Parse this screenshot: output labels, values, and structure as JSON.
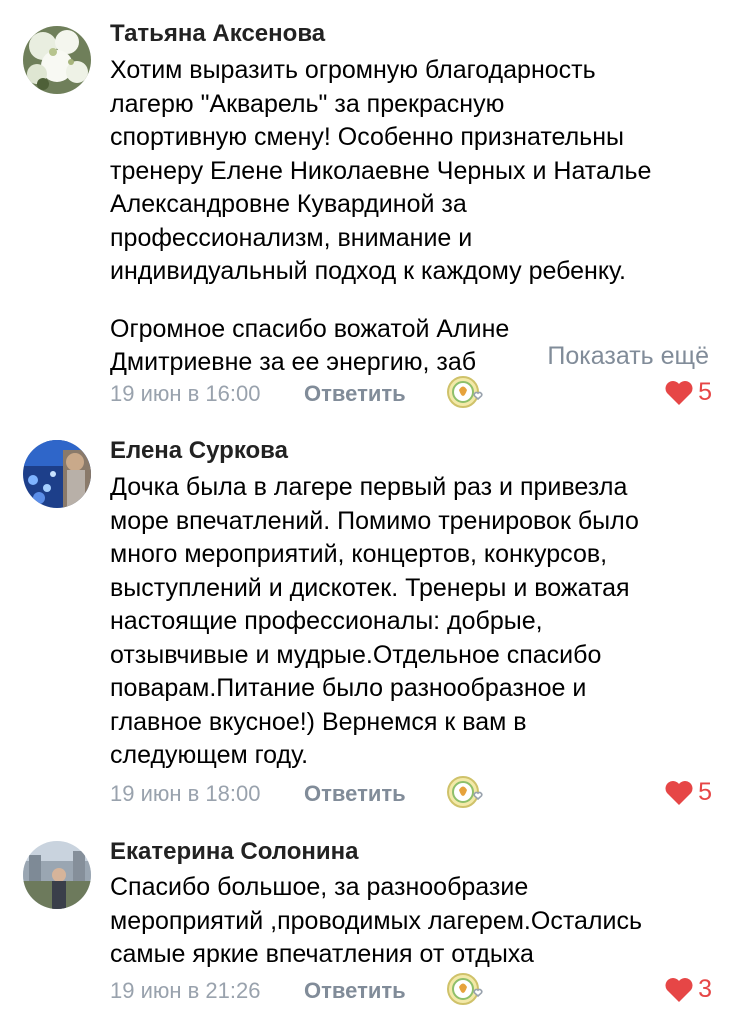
{
  "colors": {
    "name": "#222222",
    "text": "#000000",
    "meta": "#99a2ad",
    "reply": "#818c99",
    "like": "#e64646"
  },
  "comments": [
    {
      "author": "Татьяна Аксенова",
      "avatar_icon": "avatar-photo-flowers",
      "lines": [
        "Хотим выразить огромную благодарность",
        "лагерю \"Акварель\" за прекрасную",
        "спортивную смену! Особенно признательны",
        "тренеру Елене Николаевне Черных и Наталье",
        "Александровне Кувардиной за",
        "профессионализм, внимание и",
        "индивидуальный подход к каждому ребенку."
      ],
      "lines2": [
        "Огромное спасибо вожатой Алине",
        "Дмитриевне за ее энергию, заб"
      ],
      "show_more": "Показать ещё",
      "date": "19 июн в 16:00",
      "reply": "Ответить",
      "likes": "5"
    },
    {
      "author": "Елена Суркова",
      "avatar_icon": "avatar-photo-aquarium",
      "lines": [
        "Дочка была в лагере первый раз и привезла",
        "море впечатлений. Помимо тренировок было",
        "много мероприятий, концертов, конкурсов,",
        "выступлений и дискотек. Тренеры и вожатая",
        "настоящие профессионалы: добрые,",
        "отзывчивые и мудрые.Отдельное спасибо",
        "поварам.Питание было разнообразное и",
        "главное вкусное!) Вернемся к вам в",
        "следующем году."
      ],
      "date": "19 июн в 18:00",
      "reply": "Ответить",
      "likes": "5"
    },
    {
      "author": "Екатерина Солонина",
      "avatar_icon": "avatar-photo-city",
      "lines": [
        "Спасибо большое, за разнообразие",
        "мероприятий ,проводимых лагерем.Остались",
        "самые яркие впечатления от отдыха"
      ],
      "date": "19 июн в 21:26",
      "reply": "Ответить",
      "likes": "3"
    }
  ]
}
